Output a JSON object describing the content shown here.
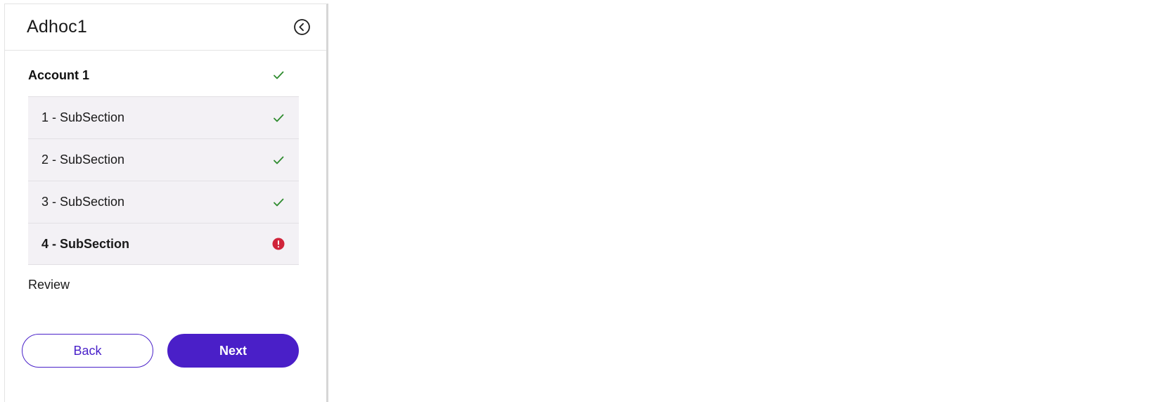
{
  "panel": {
    "title": "Adhoc1",
    "collapse_icon": "chevron-left-circle-icon"
  },
  "nav": {
    "section": {
      "label": "Account 1",
      "status": "complete"
    },
    "subsections": [
      {
        "label": "1 - SubSection",
        "status": "complete"
      },
      {
        "label": "2 - SubSection",
        "status": "complete"
      },
      {
        "label": "3 - SubSection",
        "status": "complete"
      },
      {
        "label": "4 - SubSection",
        "status": "error"
      }
    ],
    "review_label": "Review"
  },
  "footer": {
    "back_label": "Back",
    "next_label": "Next"
  },
  "colors": {
    "accent": "#4a1fc8",
    "success": "#2e8b2e",
    "error": "#d0243a",
    "subsection_bg": "#f3f1f5"
  }
}
